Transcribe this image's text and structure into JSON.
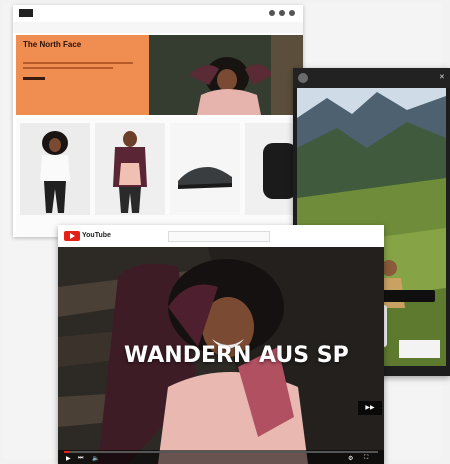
{
  "site": {
    "logo_text": "",
    "nav": [
      "",
      ""
    ],
    "brand_badge": "",
    "brand_name": "",
    "menu": [
      "",
      "",
      "",
      "",
      "",
      "",
      "",
      "",
      ""
    ],
    "hero": {
      "title": "The North Face",
      "subtitle": ""
    },
    "products": [
      {
        "label": ""
      },
      {
        "label": ""
      },
      {
        "label": ""
      },
      {
        "label": ""
      }
    ]
  },
  "story": {
    "handle": "",
    "close_icon": "close-icon",
    "question_text": "",
    "reply_text": "",
    "tag_text": "",
    "footer_text": ""
  },
  "video": {
    "platform_word": "YouTube",
    "caption": "WANDERN AUS SP",
    "progress": 0.02,
    "colors": {
      "accent": "#e62117"
    }
  },
  "colors": {
    "hero_orange": "#f08e52",
    "dark": "#1d1d1d"
  }
}
